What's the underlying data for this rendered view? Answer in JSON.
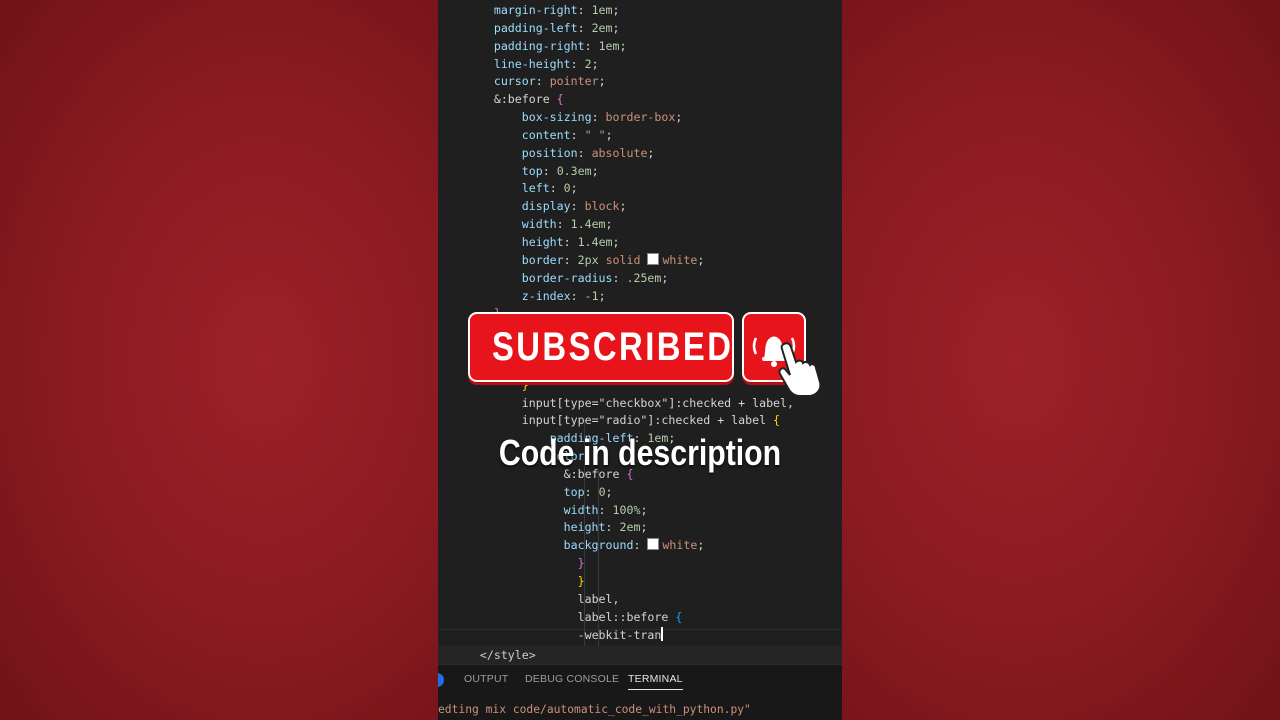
{
  "editor": {
    "lines": [
      [
        {
          "t": "        ",
          "c": "w"
        },
        {
          "t": "margin-right",
          "c": "p"
        },
        {
          "t": ": ",
          "c": "w"
        },
        {
          "t": "1em",
          "c": "n"
        },
        {
          "t": ";",
          "c": "w"
        }
      ],
      [
        {
          "t": "        ",
          "c": "w"
        },
        {
          "t": "padding-left",
          "c": "p"
        },
        {
          "t": ": ",
          "c": "w"
        },
        {
          "t": "2em",
          "c": "n"
        },
        {
          "t": ";",
          "c": "w"
        }
      ],
      [
        {
          "t": "        ",
          "c": "w"
        },
        {
          "t": "padding-right",
          "c": "p"
        },
        {
          "t": ": ",
          "c": "w"
        },
        {
          "t": "1em",
          "c": "n"
        },
        {
          "t": ";",
          "c": "w"
        }
      ],
      [
        {
          "t": "        ",
          "c": "w"
        },
        {
          "t": "line-height",
          "c": "p"
        },
        {
          "t": ": ",
          "c": "w"
        },
        {
          "t": "2",
          "c": "n"
        },
        {
          "t": ";",
          "c": "w"
        }
      ],
      [
        {
          "t": "        ",
          "c": "w"
        },
        {
          "t": "cursor",
          "c": "p"
        },
        {
          "t": ": ",
          "c": "w"
        },
        {
          "t": "pointer",
          "c": "v"
        },
        {
          "t": ";",
          "c": "w"
        }
      ],
      [
        {
          "t": "        ",
          "c": "w"
        },
        {
          "t": "&:before ",
          "c": "w"
        },
        {
          "t": "{",
          "c": "b2"
        }
      ],
      [
        {
          "t": "            ",
          "c": "w"
        },
        {
          "t": "box-sizing",
          "c": "p"
        },
        {
          "t": ": ",
          "c": "w"
        },
        {
          "t": "border-box",
          "c": "v"
        },
        {
          "t": ";",
          "c": "w"
        }
      ],
      [
        {
          "t": "            ",
          "c": "w"
        },
        {
          "t": "content",
          "c": "p"
        },
        {
          "t": ": ",
          "c": "w"
        },
        {
          "t": "\" \"",
          "c": "v"
        },
        {
          "t": ";",
          "c": "w"
        }
      ],
      [
        {
          "t": "            ",
          "c": "w"
        },
        {
          "t": "position",
          "c": "p"
        },
        {
          "t": ": ",
          "c": "w"
        },
        {
          "t": "absolute",
          "c": "v"
        },
        {
          "t": ";",
          "c": "w"
        }
      ],
      [
        {
          "t": "            ",
          "c": "w"
        },
        {
          "t": "top",
          "c": "p"
        },
        {
          "t": ": ",
          "c": "w"
        },
        {
          "t": "0.3em",
          "c": "n"
        },
        {
          "t": ";",
          "c": "w"
        }
      ],
      [
        {
          "t": "            ",
          "c": "w"
        },
        {
          "t": "left",
          "c": "p"
        },
        {
          "t": ": ",
          "c": "w"
        },
        {
          "t": "0",
          "c": "n"
        },
        {
          "t": ";",
          "c": "w"
        }
      ],
      [
        {
          "t": "            ",
          "c": "w"
        },
        {
          "t": "display",
          "c": "p"
        },
        {
          "t": ": ",
          "c": "w"
        },
        {
          "t": "block",
          "c": "v"
        },
        {
          "t": ";",
          "c": "w"
        }
      ],
      [
        {
          "t": "            ",
          "c": "w"
        },
        {
          "t": "width",
          "c": "p"
        },
        {
          "t": ": ",
          "c": "w"
        },
        {
          "t": "1.4em",
          "c": "n"
        },
        {
          "t": ";",
          "c": "w"
        }
      ],
      [
        {
          "t": "            ",
          "c": "w"
        },
        {
          "t": "height",
          "c": "p"
        },
        {
          "t": ": ",
          "c": "w"
        },
        {
          "t": "1.4em",
          "c": "n"
        },
        {
          "t": ";",
          "c": "w"
        }
      ],
      [
        {
          "t": "            ",
          "c": "w"
        },
        {
          "t": "border",
          "c": "p"
        },
        {
          "t": ": ",
          "c": "w"
        },
        {
          "t": "2px",
          "c": "n"
        },
        {
          "t": " ",
          "c": "w"
        },
        {
          "t": "solid",
          "c": "v"
        },
        {
          "t": " ",
          "c": "w"
        },
        {
          "t": "",
          "c": "swatch"
        },
        {
          "t": "white",
          "c": "v"
        },
        {
          "t": ";",
          "c": "w"
        }
      ],
      [
        {
          "t": "            ",
          "c": "w"
        },
        {
          "t": "border-radius",
          "c": "p"
        },
        {
          "t": ": ",
          "c": "w"
        },
        {
          "t": ".25em",
          "c": "n"
        },
        {
          "t": ";",
          "c": "w"
        }
      ],
      [
        {
          "t": "            ",
          "c": "w"
        },
        {
          "t": "z-index",
          "c": "p"
        },
        {
          "t": ": ",
          "c": "w"
        },
        {
          "t": "-1",
          "c": "n"
        },
        {
          "t": ";",
          "c": "w"
        }
      ],
      [
        {
          "t": "        ",
          "c": "w"
        },
        {
          "t": "}",
          "c": "b2"
        }
      ],
      [
        {
          "t": "",
          "c": "w"
        }
      ],
      [
        {
          "t": "            ",
          "c": "w"
        },
        {
          "t": "",
          "c": "w"
        }
      ],
      [
        {
          "t": "        ",
          "c": "w"
        },
        {
          "t": "",
          "c": "w"
        }
      ],
      [
        {
          "t": "            ",
          "c": "w"
        },
        {
          "t": "}",
          "c": "b1"
        }
      ],
      [
        {
          "t": "            ",
          "c": "w"
        },
        {
          "t": "input[type=\"checkbox\"]:checked + label,",
          "c": "w"
        }
      ],
      [
        {
          "t": "            ",
          "c": "w"
        },
        {
          "t": "input[type=\"radio\"]:checked + label ",
          "c": "w"
        },
        {
          "t": "{",
          "c": "b1"
        }
      ],
      [
        {
          "t": "                ",
          "c": "w"
        },
        {
          "t": "padding-left",
          "c": "p"
        },
        {
          "t": ": ",
          "c": "w"
        },
        {
          "t": "1em",
          "c": "n"
        },
        {
          "t": ";",
          "c": "w"
        }
      ],
      [
        {
          "t": "                ",
          "c": "w"
        },
        {
          "t": "color",
          "c": "p"
        },
        {
          "t": ": ",
          "c": "w"
        },
        {
          "t": "",
          "c": "w"
        }
      ],
      [
        {
          "t": "                  ",
          "c": "w"
        },
        {
          "t": "&:before ",
          "c": "w"
        },
        {
          "t": "{",
          "c": "b2"
        }
      ],
      [
        {
          "t": "                  ",
          "c": "w"
        },
        {
          "t": "top",
          "c": "p"
        },
        {
          "t": ": ",
          "c": "w"
        },
        {
          "t": "0",
          "c": "n"
        },
        {
          "t": ";",
          "c": "w"
        }
      ],
      [
        {
          "t": "                  ",
          "c": "w"
        },
        {
          "t": "width",
          "c": "p"
        },
        {
          "t": ": ",
          "c": "w"
        },
        {
          "t": "100%",
          "c": "n"
        },
        {
          "t": ";",
          "c": "w"
        }
      ],
      [
        {
          "t": "                  ",
          "c": "w"
        },
        {
          "t": "height",
          "c": "p"
        },
        {
          "t": ": ",
          "c": "w"
        },
        {
          "t": "2em",
          "c": "n"
        },
        {
          "t": ";",
          "c": "w"
        }
      ],
      [
        {
          "t": "                  ",
          "c": "w"
        },
        {
          "t": "background",
          "c": "p"
        },
        {
          "t": ": ",
          "c": "w"
        },
        {
          "t": "",
          "c": "swatch"
        },
        {
          "t": "white",
          "c": "v"
        },
        {
          "t": ";",
          "c": "w"
        }
      ],
      [
        {
          "t": "                    ",
          "c": "w"
        },
        {
          "t": "}",
          "c": "b2"
        }
      ],
      [
        {
          "t": "                    ",
          "c": "w"
        },
        {
          "t": "}",
          "c": "b1"
        }
      ],
      [
        {
          "t": "                    ",
          "c": "w"
        },
        {
          "t": "label,",
          "c": "w"
        }
      ],
      [
        {
          "t": "                    ",
          "c": "w"
        },
        {
          "t": "label::before ",
          "c": "w"
        },
        {
          "t": "{",
          "c": "b3"
        }
      ],
      [
        {
          "t": "                    ",
          "c": "w"
        },
        {
          "t": "-webkit-tran",
          "c": "w"
        },
        {
          "t": "",
          "c": "cursor"
        }
      ]
    ],
    "style_close": "      </style>"
  },
  "panel": {
    "tabs": [
      "OUTPUT",
      "DEBUG CONSOLE",
      "TERMINAL"
    ],
    "active_tab": "TERMINAL",
    "terminal_line": "edting mix code/automatic_code_with_python.py\""
  },
  "overlay": {
    "subscribed_label": "SUBSCRIBED",
    "caption": "Code in description"
  },
  "colors": {
    "background_red": "#8a1a20",
    "button_red": "#e8141c",
    "editor_bg": "#1f1f1f",
    "property": "#9cdcfe",
    "string_value": "#ce9178",
    "number": "#b5cea8"
  },
  "icons": {
    "bell": "bell-icon",
    "hand": "pointing-hand-icon"
  }
}
